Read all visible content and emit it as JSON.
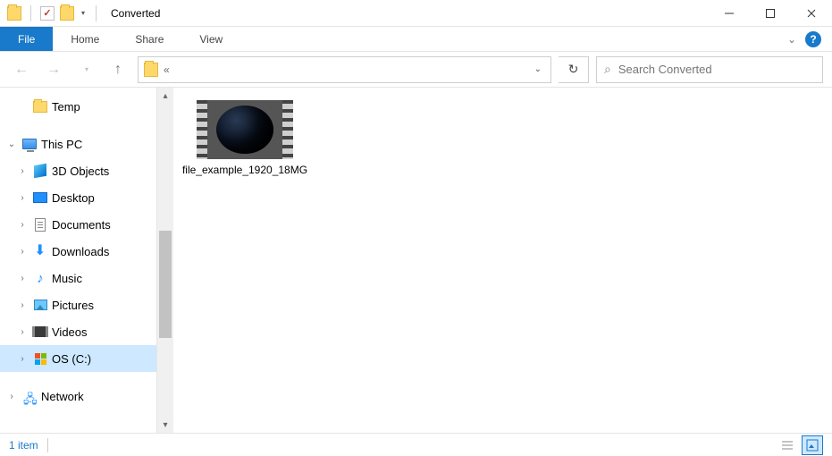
{
  "window": {
    "title": "Converted"
  },
  "ribbon": {
    "file_label": "File",
    "tabs": [
      "Home",
      "Share",
      "View"
    ]
  },
  "nav": {
    "address_hint": "«",
    "search_placeholder": "Search Converted"
  },
  "tree": {
    "quick": {
      "label": "Temp"
    },
    "this_pc": {
      "label": "This PC"
    },
    "children": [
      {
        "label": "3D Objects",
        "icon": "3d"
      },
      {
        "label": "Desktop",
        "icon": "desktop"
      },
      {
        "label": "Documents",
        "icon": "doc"
      },
      {
        "label": "Downloads",
        "icon": "download"
      },
      {
        "label": "Music",
        "icon": "music"
      },
      {
        "label": "Pictures",
        "icon": "picture"
      },
      {
        "label": "Videos",
        "icon": "video"
      },
      {
        "label": "OS (C:)",
        "icon": "drive",
        "selected": true
      }
    ],
    "network": {
      "label": "Network"
    }
  },
  "files": [
    {
      "name": "file_example_1920_18MG",
      "type": "video"
    }
  ],
  "status": {
    "item_count": "1 item"
  }
}
